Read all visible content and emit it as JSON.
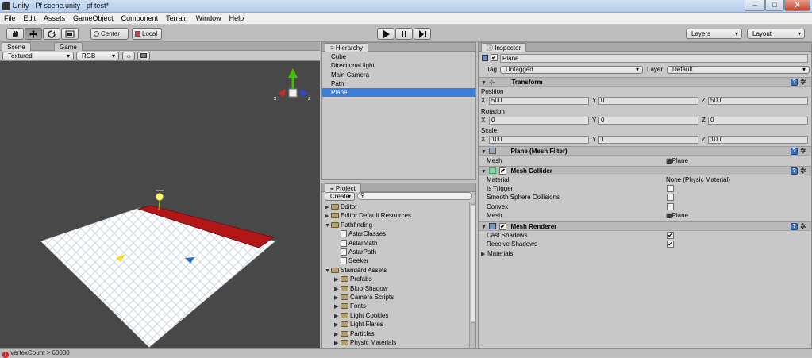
{
  "window": {
    "title": "Unity - Pf scene.unity - pf test*",
    "buttons": [
      "–",
      "□",
      "X"
    ]
  },
  "menu": [
    "File",
    "Edit",
    "Assets",
    "GameObject",
    "Component",
    "Terrain",
    "Window",
    "Help"
  ],
  "toolbar": {
    "center": "Center",
    "local": "Local",
    "layers": "Layers",
    "layout": "Layout"
  },
  "scene": {
    "tabs": [
      "Scene",
      "Game"
    ],
    "render_mode": "Textured",
    "color_mode": "RGB",
    "gizmo_x": "x",
    "gizmo_z": "z"
  },
  "hierarchy": {
    "tab": "Hierarchy",
    "items": [
      "Cube",
      "Directional light",
      "Main Camera",
      "Path",
      "Plane"
    ],
    "selected": 4
  },
  "project": {
    "tab": "Project",
    "create": "Create",
    "items": [
      {
        "label": "Editor",
        "level": 0,
        "type": "folder",
        "arrow": "▶"
      },
      {
        "label": "Editor Default Resources",
        "level": 0,
        "type": "folder",
        "arrow": "▶"
      },
      {
        "label": "Pathfinding",
        "level": 0,
        "type": "folder",
        "arrow": "▼"
      },
      {
        "label": "AstarClasses",
        "level": 1,
        "type": "script",
        "arrow": ""
      },
      {
        "label": "AstarMath",
        "level": 1,
        "type": "script",
        "arrow": ""
      },
      {
        "label": "AstarPath",
        "level": 1,
        "type": "script",
        "arrow": ""
      },
      {
        "label": "Seeker",
        "level": 1,
        "type": "script",
        "arrow": ""
      },
      {
        "label": "Standard Assets",
        "level": 0,
        "type": "folder",
        "arrow": "▼"
      },
      {
        "label": "Prefabs",
        "level": 1,
        "type": "folder",
        "arrow": "▶"
      },
      {
        "label": "Blob-Shadow",
        "level": 1,
        "type": "folder",
        "arrow": "▶"
      },
      {
        "label": "Camera Scripts",
        "level": 1,
        "type": "folder",
        "arrow": "▶"
      },
      {
        "label": "Fonts",
        "level": 1,
        "type": "folder",
        "arrow": "▶"
      },
      {
        "label": "Light Cookies",
        "level": 1,
        "type": "folder",
        "arrow": "▶"
      },
      {
        "label": "Light Flares",
        "level": 1,
        "type": "folder",
        "arrow": "▶"
      },
      {
        "label": "Particles",
        "level": 1,
        "type": "folder",
        "arrow": "▶"
      },
      {
        "label": "Physic Materials",
        "level": 1,
        "type": "folder",
        "arrow": "▶"
      }
    ]
  },
  "inspector": {
    "tab": "Inspector",
    "object_name": "Plane",
    "tag_label": "Tag",
    "tag_value": "Untagged",
    "layer_label": "Layer",
    "layer_value": "Default",
    "transform": {
      "title": "Transform",
      "position": "Position",
      "rotation": "Rotation",
      "scale": "Scale",
      "x": "X",
      "y": "Y",
      "z": "Z",
      "pos": [
        "500",
        "0",
        "500"
      ],
      "rot": [
        "0",
        "0",
        "0"
      ],
      "scl": [
        "100",
        "1",
        "100"
      ]
    },
    "mesh_filter": {
      "title": "Plane (Mesh Filter)",
      "mesh_label": "Mesh",
      "mesh_value": "Plane"
    },
    "mesh_collider": {
      "title": "Mesh Collider",
      "material_label": "Material",
      "material_value": "None (Physic Material)",
      "is_trigger": "Is Trigger",
      "smooth": "Smooth Sphere Collisions",
      "convex": "Convex",
      "mesh_label": "Mesh",
      "mesh_value": "Plane"
    },
    "mesh_renderer": {
      "title": "Mesh Renderer",
      "cast": "Cast Shadows",
      "receive": "Receive Shadows",
      "materials": "Materials"
    },
    "checkmark": "✔",
    "help": "?",
    "gear": "✲"
  },
  "status": {
    "message": "vertexCount > 60000",
    "icon": "error-icon",
    "error_color": "#d42020"
  }
}
